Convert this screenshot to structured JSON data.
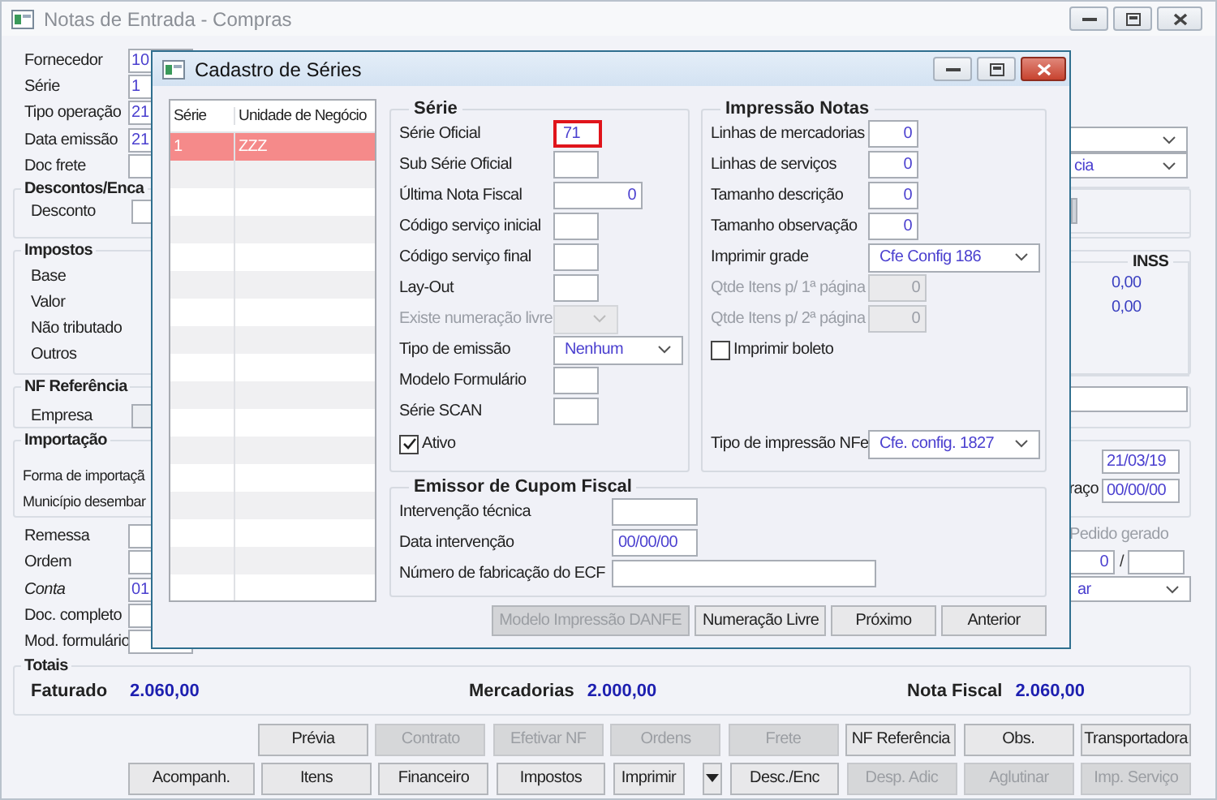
{
  "window": {
    "title": "Notas de Entrada - Compras"
  },
  "header_fields": [
    {
      "label": "Fornecedor",
      "value": "10"
    },
    {
      "label": "Série",
      "value": "1"
    },
    {
      "label": "Tipo operação",
      "value": "21"
    },
    {
      "label": "Data emissão",
      "value": "21",
      "side_combo": true
    },
    {
      "label": "Doc frete",
      "side_combo": true,
      "side_combo_value": "cia"
    }
  ],
  "descontos": {
    "title": "Descontos/Enca",
    "label": "Desconto"
  },
  "impostos": {
    "title": "Impostos",
    "labels": [
      "Base",
      "Valor",
      "Não tributado",
      "Outros"
    ],
    "inss_title": "INSS",
    "inss_values": [
      "0,00",
      "0,00"
    ]
  },
  "nf_referencia": {
    "title": "NF Referência",
    "label": "Empresa"
  },
  "importacao": {
    "title": "Importação",
    "labels": [
      "Forma de importaçã",
      "Município desembar"
    ],
    "date": "21/03/19",
    "second_label": "raço",
    "second_date": "00/00/00"
  },
  "lower_fields": [
    {
      "label": "Remessa"
    },
    {
      "label": "Ordem"
    },
    {
      "label": "Conta",
      "value": "01",
      "italic": true
    },
    {
      "label": "Doc. completo"
    },
    {
      "label": "Mod. formulário"
    }
  ],
  "pedido": {
    "label": "Pedido gerado",
    "disabled": true,
    "value": "0",
    "separator": "/",
    "combo_value": "ar"
  },
  "totals": {
    "title": "Totais",
    "items": [
      {
        "label": "Faturado",
        "value": "2.060,00"
      },
      {
        "label": "Mercadorias",
        "value": "2.000,00"
      },
      {
        "label": "Nota Fiscal",
        "value": "2.060,00"
      }
    ]
  },
  "button_rows": [
    [
      {
        "kind": "button",
        "label": "Prévia",
        "disabled": false
      },
      {
        "kind": "button",
        "label": "Contrato",
        "disabled": true
      },
      {
        "kind": "button",
        "label": "Efetivar NF",
        "disabled": true
      },
      {
        "kind": "button",
        "label": "Ordens",
        "disabled": true
      },
      {
        "kind": "button",
        "label": "Frete",
        "disabled": true
      },
      {
        "kind": "button",
        "label": "NF Referência",
        "disabled": false
      },
      {
        "kind": "button",
        "label": "Obs.",
        "disabled": false
      },
      {
        "kind": "button",
        "label": "Transportadora",
        "disabled": false
      }
    ],
    [
      {
        "kind": "wide",
        "label": "Acompanh.",
        "disabled": false
      },
      {
        "kind": "button",
        "label": "Itens",
        "disabled": false
      },
      {
        "kind": "button",
        "label": "Financeiro",
        "disabled": false
      },
      {
        "kind": "button",
        "label": "Impostos",
        "disabled": false
      },
      {
        "kind": "split",
        "label": "Imprimir",
        "disabled": false
      },
      {
        "kind": "arrow",
        "disabled": false
      },
      {
        "kind": "button",
        "label": "Desc./Enc",
        "disabled": false
      },
      {
        "kind": "button",
        "label": "Desp. Adic",
        "disabled": true
      },
      {
        "kind": "button",
        "label": "Aglutinar",
        "disabled": true
      },
      {
        "kind": "button",
        "label": "Imp. Serviço",
        "disabled": true
      }
    ]
  ],
  "dialog": {
    "title": "Cadastro de Séries",
    "list": {
      "columns": [
        "Série",
        "Unidade de Negócio"
      ],
      "rows": [
        {
          "cells": [
            "1",
            "ZZZ"
          ],
          "selected": true
        }
      ]
    },
    "serie": {
      "title": "Série",
      "fields": [
        {
          "kind": "text",
          "label": "Série Oficial",
          "value": "71",
          "highlighted": true,
          "disabled": false
        },
        {
          "kind": "text",
          "label": "Sub Série Oficial",
          "highlighted": false,
          "disabled": false
        },
        {
          "kind": "number",
          "label": "Última Nota Fiscal",
          "value": "0",
          "highlighted": false,
          "disabled": false
        },
        {
          "kind": "text",
          "label": "Código serviço inicial",
          "highlighted": false,
          "disabled": false
        },
        {
          "kind": "text",
          "label": "Código serviço final",
          "highlighted": false,
          "disabled": false
        },
        {
          "kind": "text",
          "label": "Lay-Out",
          "highlighted": false,
          "disabled": false
        },
        {
          "kind": "combo",
          "label": "Existe numeração livre",
          "disabled": true
        },
        {
          "kind": "combo",
          "label": "Tipo de emissão",
          "value": "Nenhum",
          "disabled": false
        },
        {
          "kind": "text",
          "label": "Modelo Formulário",
          "highlighted": false,
          "disabled": false
        },
        {
          "kind": "text",
          "label": "Série SCAN",
          "highlighted": false,
          "disabled": false
        },
        {
          "kind": "check",
          "label": "Ativo",
          "checked": true,
          "disabled": false
        }
      ]
    },
    "impressao": {
      "title": "Impressão Notas",
      "fields": [
        {
          "kind": "number",
          "label": "Linhas de mercadorias",
          "value": "0",
          "disabled": false
        },
        {
          "kind": "number",
          "label": "Linhas de serviços",
          "value": "0",
          "disabled": false
        },
        {
          "kind": "number",
          "label": "Tamanho descrição",
          "value": "0",
          "disabled": false
        },
        {
          "kind": "number",
          "label": "Tamanho observação",
          "value": "0",
          "disabled": false
        },
        {
          "kind": "combo",
          "label": "Imprimir grade",
          "value": "Cfe Config 186",
          "disabled": false
        },
        {
          "kind": "number",
          "label": "Qtde Itens p/ 1ª página",
          "value": "0",
          "disabled": true
        },
        {
          "kind": "number",
          "label": "Qtde Itens p/ 2ª página",
          "value": "0",
          "disabled": true
        },
        {
          "kind": "check",
          "label": "Imprimir boleto",
          "checked": false,
          "disabled": false
        },
        {
          "kind": "combo",
          "label": "Tipo de impressão NFe",
          "value": "Cfe. config. 1827",
          "disabled": false
        }
      ]
    },
    "emissor": {
      "title": "Emissor de Cupom Fiscal",
      "fields": [
        {
          "kind": "text",
          "label": "Intervenção técnica",
          "disabled": false
        },
        {
          "kind": "text",
          "label": "Data intervenção",
          "value": "00/00/00",
          "disabled": false
        },
        {
          "kind": "wide",
          "label": "Número de fabricação do ECF",
          "disabled": false
        }
      ]
    },
    "buttons": [
      {
        "label": "Modelo Impressão DANFE",
        "disabled": true
      },
      {
        "label": "Numeração Livre",
        "disabled": false
      },
      {
        "label": "Próximo",
        "disabled": false
      },
      {
        "label": "Anterior",
        "disabled": false
      }
    ]
  }
}
